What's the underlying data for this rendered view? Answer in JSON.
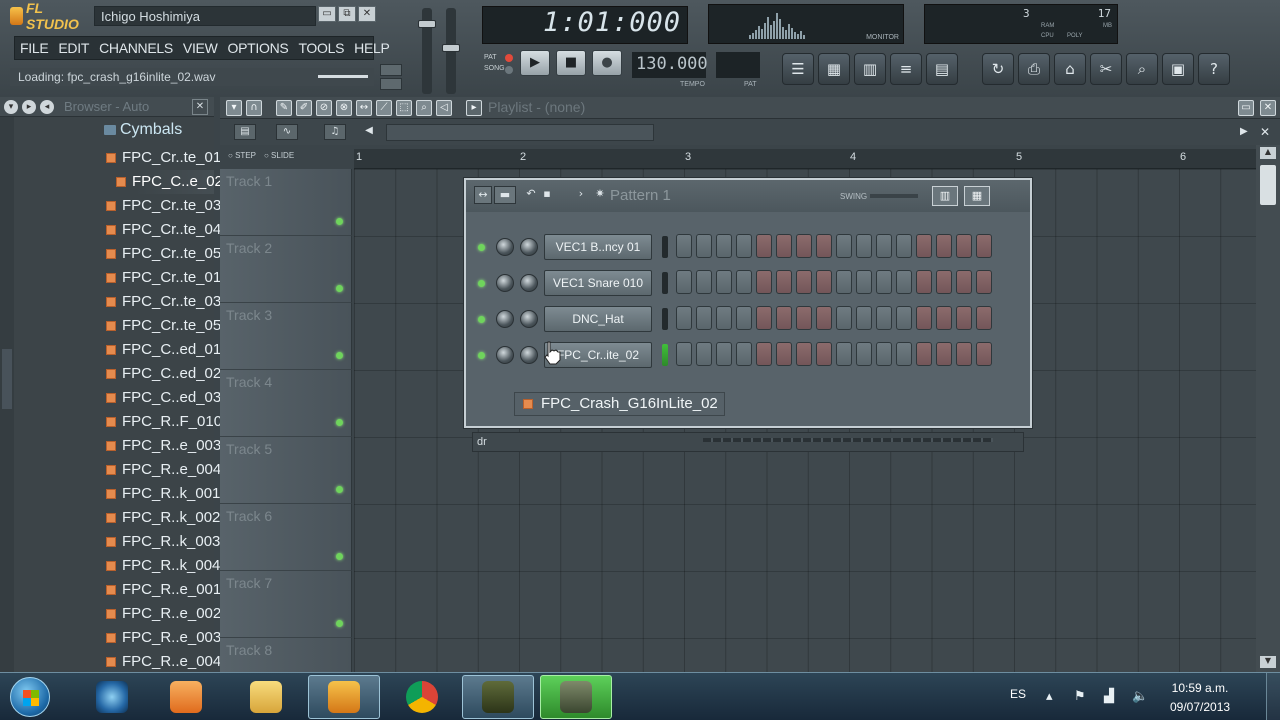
{
  "app": {
    "logo_text": "FL STUDIO",
    "username": "Ichigo Hoshimiya",
    "window_buttons": [
      "▭",
      "⧉",
      "✕"
    ]
  },
  "menu": [
    "FILE",
    "EDIT",
    "CHANNELS",
    "VIEW",
    "OPTIONS",
    "TOOLS",
    "HELP"
  ],
  "hint_bar": {
    "text": "Loading: fpc_crash_g16inlite_02.wav"
  },
  "transport": {
    "time_display": "1:01:000",
    "pat_label": "PAT",
    "song_label": "SONG",
    "play_icon": "▶",
    "stop_icon": "■",
    "record_icon": "●",
    "tempo_value": "130.000",
    "tempo_label": "TEMPO",
    "pat_box_label": "PAT"
  },
  "monitor": {
    "label": "MONITOR"
  },
  "cpu_panel": {
    "value1": "3",
    "value2": "17",
    "ram_label": "RAM",
    "cpu_label": "CPU",
    "poly_label": "POLY",
    "mb_label": "MB"
  },
  "toolbar_icons": [
    "playlist-icon",
    "step-sequencer-icon",
    "piano-roll-icon",
    "browser-icon",
    "mixer-icon",
    "undo-icon",
    "save-icon",
    "export-icon",
    "cut-icon",
    "search-icon",
    "notes-icon",
    "help-icon"
  ],
  "toolbar_glyphs": [
    "☰",
    "▦",
    "▥",
    "≡",
    "▤",
    "↻",
    "⎙",
    "⌂",
    "✂",
    "⌕",
    "▣",
    "?"
  ],
  "browser": {
    "title": "Browser - Auto",
    "folder": "Cymbals",
    "items": [
      "FPC_Cr..te_01",
      "FPC_C..e_02",
      "FPC_Cr..te_03",
      "FPC_Cr..te_04",
      "FPC_Cr..te_05",
      "FPC_Cr..te_01",
      "FPC_Cr..te_03",
      "FPC_Cr..te_05",
      "FPC_C..ed_01",
      "FPC_C..ed_02",
      "FPC_C..ed_03",
      "FPC_R..F_010",
      "FPC_R..e_003",
      "FPC_R..e_004",
      "FPC_R..k_001",
      "FPC_R..k_002",
      "FPC_R..k_003",
      "FPC_R..k_004",
      "FPC_R..e_001",
      "FPC_R..e_002",
      "FPC_R..e_003",
      "FPC_R..e_004"
    ],
    "selected_index": 1
  },
  "playlist": {
    "title": "Playlist - (none)",
    "step_label": "STEP",
    "slide_label": "SLIDE",
    "ruler": [
      "1",
      "2",
      "3",
      "4",
      "5",
      "6"
    ],
    "tracks": [
      "Track 1",
      "Track 2",
      "Track 3",
      "Track 4",
      "Track 5",
      "Track 6",
      "Track 7",
      "Track 8"
    ]
  },
  "step_sequencer": {
    "pattern_name": "Pattern 1",
    "swing_label": "SWING",
    "channels": [
      {
        "name": "VEC1 B..ncy 01",
        "meter_on": false
      },
      {
        "name": "VEC1 Snare 010",
        "meter_on": false
      },
      {
        "name": "DNC_Hat",
        "meter_on": false
      },
      {
        "name": "FPC_Cr..ite_02",
        "meter_on": true
      }
    ],
    "step_colors": [
      "g",
      "g",
      "g",
      "g",
      "r",
      "r",
      "r",
      "r",
      "g",
      "g",
      "g",
      "g",
      "r",
      "r",
      "r",
      "r"
    ],
    "footer_text": "dr",
    "drag_filename": "FPC_Crash_G16InLite_02"
  },
  "taskbar": {
    "lang": "ES",
    "time": "10:59 a.m.",
    "date": "09/07/2013"
  }
}
